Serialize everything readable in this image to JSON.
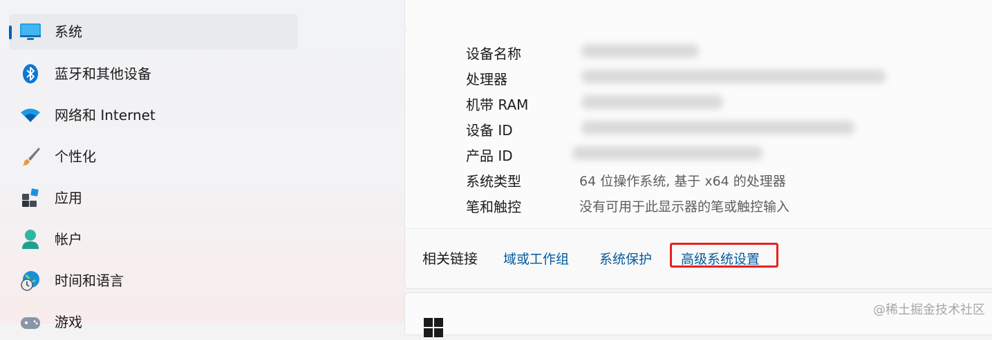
{
  "sidebar": {
    "items": [
      {
        "label": "系统",
        "icon": "monitor-icon",
        "selected": true
      },
      {
        "label": "蓝牙和其他设备",
        "icon": "bluetooth-icon"
      },
      {
        "label": "网络和 Internet",
        "icon": "wifi-icon"
      },
      {
        "label": "个性化",
        "icon": "paintbrush-icon"
      },
      {
        "label": "应用",
        "icon": "apps-icon"
      },
      {
        "label": "帐户",
        "icon": "account-icon"
      },
      {
        "label": "时间和语言",
        "icon": "clock-globe-icon"
      },
      {
        "label": "游戏",
        "icon": "gamepad-icon"
      }
    ]
  },
  "device_specs": {
    "rows": [
      {
        "label": "设备名称",
        "value": ""
      },
      {
        "label": "处理器",
        "value": ""
      },
      {
        "label": "机带 RAM",
        "value": ""
      },
      {
        "label": "设备 ID",
        "value": ""
      },
      {
        "label": "产品 ID",
        "value": ""
      },
      {
        "label": "系统类型",
        "value": "64 位操作系统, 基于 x64 的处理器"
      },
      {
        "label": "笔和触控",
        "value": "没有可用于此显示器的笔或触控输入"
      }
    ]
  },
  "related_links": {
    "label": "相关链接",
    "links": [
      "域或工作组",
      "系统保护",
      "高级系统设置"
    ]
  },
  "watermark": "@稀土掘金技术社区",
  "colors": {
    "accent": "#005fb8",
    "link": "#005a9e",
    "highlight_box": "#e81f1f"
  }
}
